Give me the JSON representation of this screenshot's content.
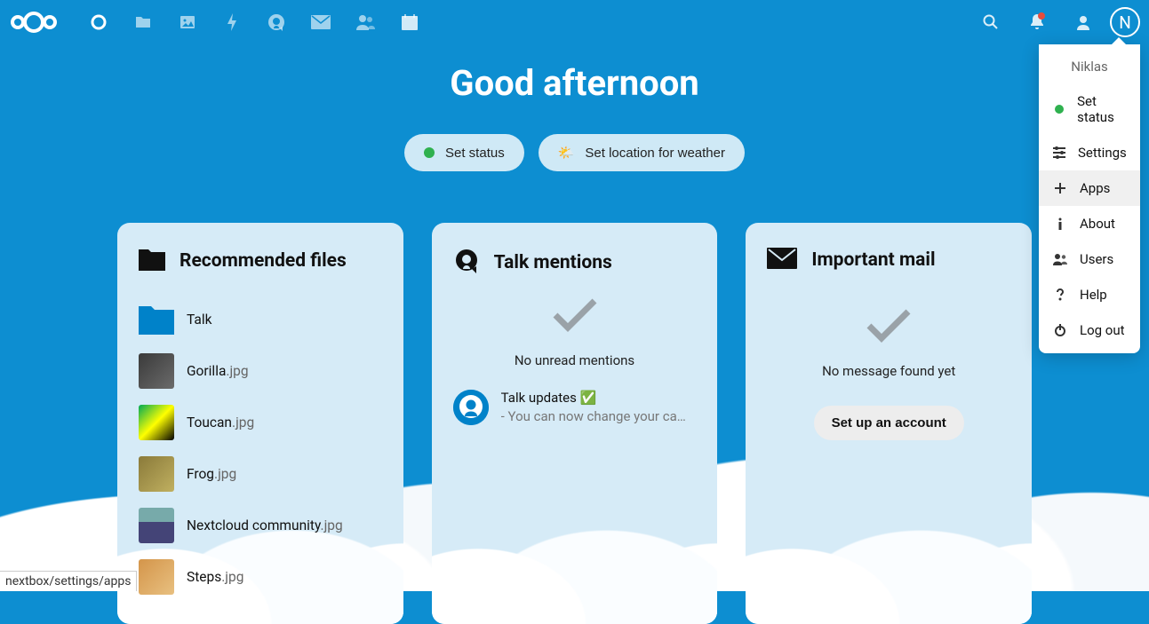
{
  "header": {
    "greeting": "Good afternoon",
    "set_status_label": "Set status",
    "set_location_label": "Set location for weather"
  },
  "user": {
    "initial": "N",
    "name": "Niklas"
  },
  "dropdown": {
    "items": [
      {
        "icon": "status-dot",
        "label": "Set status"
      },
      {
        "icon": "settings",
        "label": "Settings"
      },
      {
        "icon": "plus",
        "label": "Apps",
        "active": true
      },
      {
        "icon": "info",
        "label": "About"
      },
      {
        "icon": "users",
        "label": "Users"
      },
      {
        "icon": "help",
        "label": "Help"
      },
      {
        "icon": "power",
        "label": "Log out"
      }
    ]
  },
  "cards": {
    "recommended": {
      "title": "Recommended files",
      "items": [
        {
          "name": "Talk",
          "ext": "",
          "type": "folder"
        },
        {
          "name": "Gorilla",
          "ext": ".jpg",
          "type": "image",
          "thumb": "th-gorilla"
        },
        {
          "name": "Toucan",
          "ext": ".jpg",
          "type": "image",
          "thumb": "th-toucan"
        },
        {
          "name": "Frog",
          "ext": ".jpg",
          "type": "image",
          "thumb": "th-frog"
        },
        {
          "name": "Nextcloud community",
          "ext": ".jpg",
          "type": "image",
          "thumb": "th-community"
        },
        {
          "name": "Steps",
          "ext": ".jpg",
          "type": "image",
          "thumb": "th-steps"
        }
      ]
    },
    "talk": {
      "title": "Talk mentions",
      "empty_text": "No unread mentions",
      "mention": {
        "title": "Talk updates ✅",
        "subtitle": "- You can now change your came…"
      }
    },
    "mail": {
      "title": "Important mail",
      "empty_text": "No message found yet",
      "setup_button": "Set up an account"
    }
  },
  "status_link": "nextbox/settings/apps"
}
